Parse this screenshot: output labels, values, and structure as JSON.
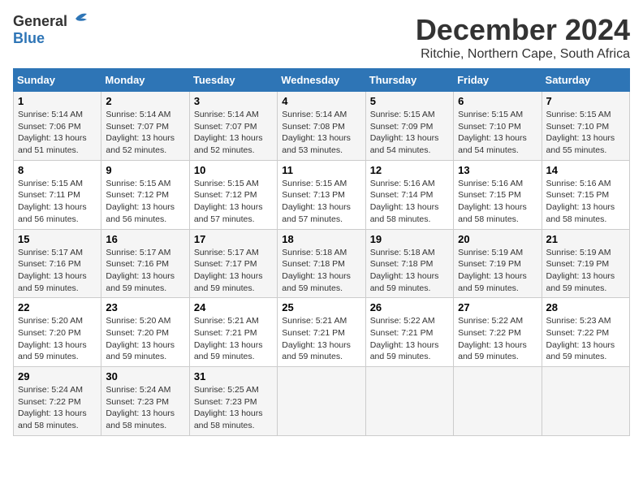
{
  "header": {
    "logo_general": "General",
    "logo_blue": "Blue",
    "month": "December 2024",
    "location": "Ritchie, Northern Cape, South Africa"
  },
  "days_of_week": [
    "Sunday",
    "Monday",
    "Tuesday",
    "Wednesday",
    "Thursday",
    "Friday",
    "Saturday"
  ],
  "weeks": [
    [
      {
        "day": "1",
        "sunrise": "5:14 AM",
        "sunset": "7:06 PM",
        "daylight": "13 hours and 51 minutes."
      },
      {
        "day": "2",
        "sunrise": "5:14 AM",
        "sunset": "7:07 PM",
        "daylight": "13 hours and 52 minutes."
      },
      {
        "day": "3",
        "sunrise": "5:14 AM",
        "sunset": "7:07 PM",
        "daylight": "13 hours and 52 minutes."
      },
      {
        "day": "4",
        "sunrise": "5:14 AM",
        "sunset": "7:08 PM",
        "daylight": "13 hours and 53 minutes."
      },
      {
        "day": "5",
        "sunrise": "5:15 AM",
        "sunset": "7:09 PM",
        "daylight": "13 hours and 54 minutes."
      },
      {
        "day": "6",
        "sunrise": "5:15 AM",
        "sunset": "7:10 PM",
        "daylight": "13 hours and 54 minutes."
      },
      {
        "day": "7",
        "sunrise": "5:15 AM",
        "sunset": "7:10 PM",
        "daylight": "13 hours and 55 minutes."
      }
    ],
    [
      {
        "day": "8",
        "sunrise": "5:15 AM",
        "sunset": "7:11 PM",
        "daylight": "13 hours and 56 minutes."
      },
      {
        "day": "9",
        "sunrise": "5:15 AM",
        "sunset": "7:12 PM",
        "daylight": "13 hours and 56 minutes."
      },
      {
        "day": "10",
        "sunrise": "5:15 AM",
        "sunset": "7:12 PM",
        "daylight": "13 hours and 57 minutes."
      },
      {
        "day": "11",
        "sunrise": "5:15 AM",
        "sunset": "7:13 PM",
        "daylight": "13 hours and 57 minutes."
      },
      {
        "day": "12",
        "sunrise": "5:16 AM",
        "sunset": "7:14 PM",
        "daylight": "13 hours and 58 minutes."
      },
      {
        "day": "13",
        "sunrise": "5:16 AM",
        "sunset": "7:15 PM",
        "daylight": "13 hours and 58 minutes."
      },
      {
        "day": "14",
        "sunrise": "5:16 AM",
        "sunset": "7:15 PM",
        "daylight": "13 hours and 58 minutes."
      }
    ],
    [
      {
        "day": "15",
        "sunrise": "5:17 AM",
        "sunset": "7:16 PM",
        "daylight": "13 hours and 59 minutes."
      },
      {
        "day": "16",
        "sunrise": "5:17 AM",
        "sunset": "7:16 PM",
        "daylight": "13 hours and 59 minutes."
      },
      {
        "day": "17",
        "sunrise": "5:17 AM",
        "sunset": "7:17 PM",
        "daylight": "13 hours and 59 minutes."
      },
      {
        "day": "18",
        "sunrise": "5:18 AM",
        "sunset": "7:18 PM",
        "daylight": "13 hours and 59 minutes."
      },
      {
        "day": "19",
        "sunrise": "5:18 AM",
        "sunset": "7:18 PM",
        "daylight": "13 hours and 59 minutes."
      },
      {
        "day": "20",
        "sunrise": "5:19 AM",
        "sunset": "7:19 PM",
        "daylight": "13 hours and 59 minutes."
      },
      {
        "day": "21",
        "sunrise": "5:19 AM",
        "sunset": "7:19 PM",
        "daylight": "13 hours and 59 minutes."
      }
    ],
    [
      {
        "day": "22",
        "sunrise": "5:20 AM",
        "sunset": "7:20 PM",
        "daylight": "13 hours and 59 minutes."
      },
      {
        "day": "23",
        "sunrise": "5:20 AM",
        "sunset": "7:20 PM",
        "daylight": "13 hours and 59 minutes."
      },
      {
        "day": "24",
        "sunrise": "5:21 AM",
        "sunset": "7:21 PM",
        "daylight": "13 hours and 59 minutes."
      },
      {
        "day": "25",
        "sunrise": "5:21 AM",
        "sunset": "7:21 PM",
        "daylight": "13 hours and 59 minutes."
      },
      {
        "day": "26",
        "sunrise": "5:22 AM",
        "sunset": "7:21 PM",
        "daylight": "13 hours and 59 minutes."
      },
      {
        "day": "27",
        "sunrise": "5:22 AM",
        "sunset": "7:22 PM",
        "daylight": "13 hours and 59 minutes."
      },
      {
        "day": "28",
        "sunrise": "5:23 AM",
        "sunset": "7:22 PM",
        "daylight": "13 hours and 59 minutes."
      }
    ],
    [
      {
        "day": "29",
        "sunrise": "5:24 AM",
        "sunset": "7:22 PM",
        "daylight": "13 hours and 58 minutes."
      },
      {
        "day": "30",
        "sunrise": "5:24 AM",
        "sunset": "7:23 PM",
        "daylight": "13 hours and 58 minutes."
      },
      {
        "day": "31",
        "sunrise": "5:25 AM",
        "sunset": "7:23 PM",
        "daylight": "13 hours and 58 minutes."
      },
      null,
      null,
      null,
      null
    ]
  ]
}
